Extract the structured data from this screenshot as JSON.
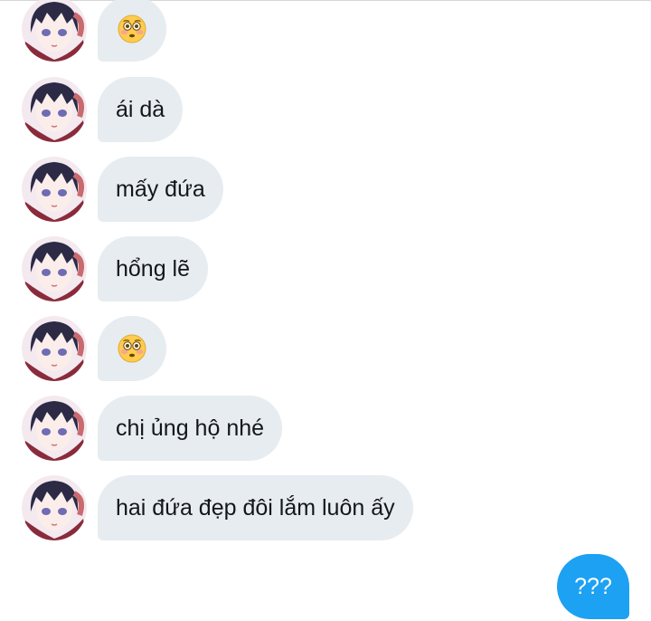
{
  "messages": [
    {
      "type": "emoji",
      "emoji": "flushed-face-icon"
    },
    {
      "type": "text",
      "text": "ái dà"
    },
    {
      "type": "text",
      "text": "mấy đứa"
    },
    {
      "type": "text",
      "text": "hổng lẽ"
    },
    {
      "type": "emoji",
      "emoji": "flushed-face-icon"
    },
    {
      "type": "text",
      "text": "chị ủng hộ nhé"
    },
    {
      "type": "text",
      "text": "hai đứa đẹp đôi lắm luôn ấy"
    }
  ],
  "sent_message": {
    "text": "???"
  },
  "colors": {
    "received_bubble": "#e6ecf0",
    "sent_bubble": "#1da1f2",
    "text": "#14171a"
  }
}
